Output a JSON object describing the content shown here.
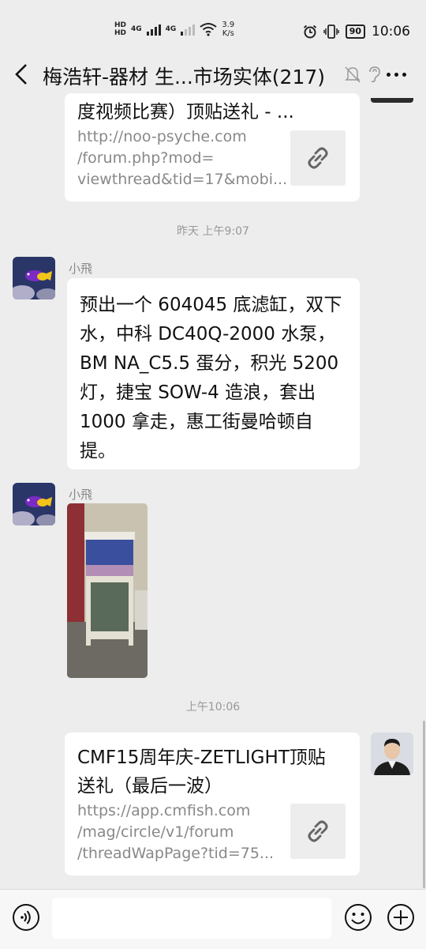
{
  "status_bar": {
    "network_a": "4G",
    "network_b": "4G",
    "hd": "HD",
    "speed_value": "3.9",
    "speed_unit": "K/s",
    "battery": "90",
    "time": "10:06"
  },
  "header": {
    "title": "梅浩轩-器材 生...市场实体(217)"
  },
  "messages": {
    "link_card_1": {
      "title": "度视频比赛）顶贴送礼 - ...",
      "desc_lines": [
        "http://noo-psyche.com",
        "/forum.php?mod=",
        "viewthread&tid=17&mobi..."
      ]
    },
    "time_1": "昨天 上午9:07",
    "sender_1": "小飛",
    "text_1_lines": [
      "预出一个 604045 底滤缸，双下",
      "水，中科 DC40Q-2000 水泵，",
      "BM NA_C5.5 蛋分，积光 5200",
      "灯，捷宝 SOW-4 造浪，套出",
      "1000 拿走，惠工街曼哈顿自",
      "提。"
    ],
    "sender_2": "小飛",
    "time_2": "上午10:06",
    "link_card_2": {
      "title_lines": [
        "CMF15周年庆-ZETLIGHT顶贴",
        "送礼（最后一波）"
      ],
      "desc_lines": [
        "https://app.cmfish.com",
        "/mag/circle/v1/forum",
        "/threadWapPage?tid=75..."
      ]
    }
  },
  "colors": {
    "background": "#ededed",
    "bubble": "#ffffff",
    "meta_text": "#999999",
    "link_desc": "#888888"
  }
}
